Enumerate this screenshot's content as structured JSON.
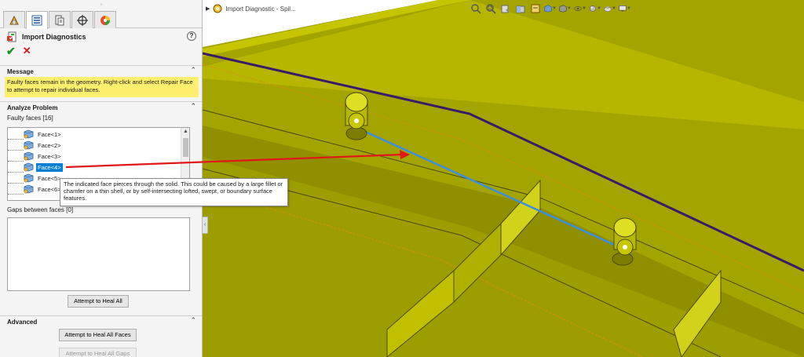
{
  "panel": {
    "tabs": [
      {
        "name": "feature-manager-icon"
      },
      {
        "name": "property-manager-icon"
      },
      {
        "name": "configuration-manager-icon"
      },
      {
        "name": "dimxpert-icon"
      },
      {
        "name": "display-manager-icon"
      }
    ],
    "title": "Import Diagnostics",
    "help_symbol": "?",
    "ok_symbol": "✔",
    "cancel_symbol": "✕",
    "message_section": {
      "label": "Message",
      "text": "Faulty faces remain in the geometry. Right-click and select Repair Face to attempt to repair individual faces."
    },
    "analyze_section": {
      "label": "Analyze Problem",
      "faulty_faces_label": "Faulty faces [16]",
      "faces": [
        {
          "label": "Face<1>",
          "selected": false
        },
        {
          "label": "Face<2>",
          "selected": false
        },
        {
          "label": "Face<3>",
          "selected": false
        },
        {
          "label": "Face<4>",
          "selected": true
        },
        {
          "label": "Face<5>",
          "selected": false
        },
        {
          "label": "Face<6>",
          "selected": false
        }
      ],
      "gaps_label": "Gaps between faces [0]",
      "heal_all_button": "Attempt to Heal All"
    },
    "advanced_section": {
      "label": "Advanced",
      "heal_faces_button": "Attempt to Heal All Faces",
      "heal_gaps_button": "Attempt to Heal All Gaps"
    }
  },
  "viewport": {
    "document_tab": "Import Diagnostic - Spil...",
    "heads_up_toolbar": [
      "zoom-to-fit-icon",
      "zoom-to-area-icon",
      "previous-view-icon",
      "section-view-icon",
      "dynamic-annotation-icon",
      "view-orientation-icon",
      "display-style-icon",
      "hide-show-items-icon",
      "edit-appearance-icon",
      "apply-scene-icon",
      "view-settings-icon"
    ]
  },
  "tooltip": {
    "text": "The indicated face pierces through the solid. This could be caused by a large fillet or chamfer on a thin shell, or by self-intersecting lofted, swept, or boundary surface features."
  },
  "colors": {
    "model_face_top": "#a4a400",
    "model_face_light": "#d2d21a",
    "model_face_dark": "#7c7c00",
    "highlight_edge": "#3a8fe0",
    "message_bg": "#ffef6e",
    "selection_bg": "#0a7fd6",
    "annotation_arrow": "#e01818"
  }
}
